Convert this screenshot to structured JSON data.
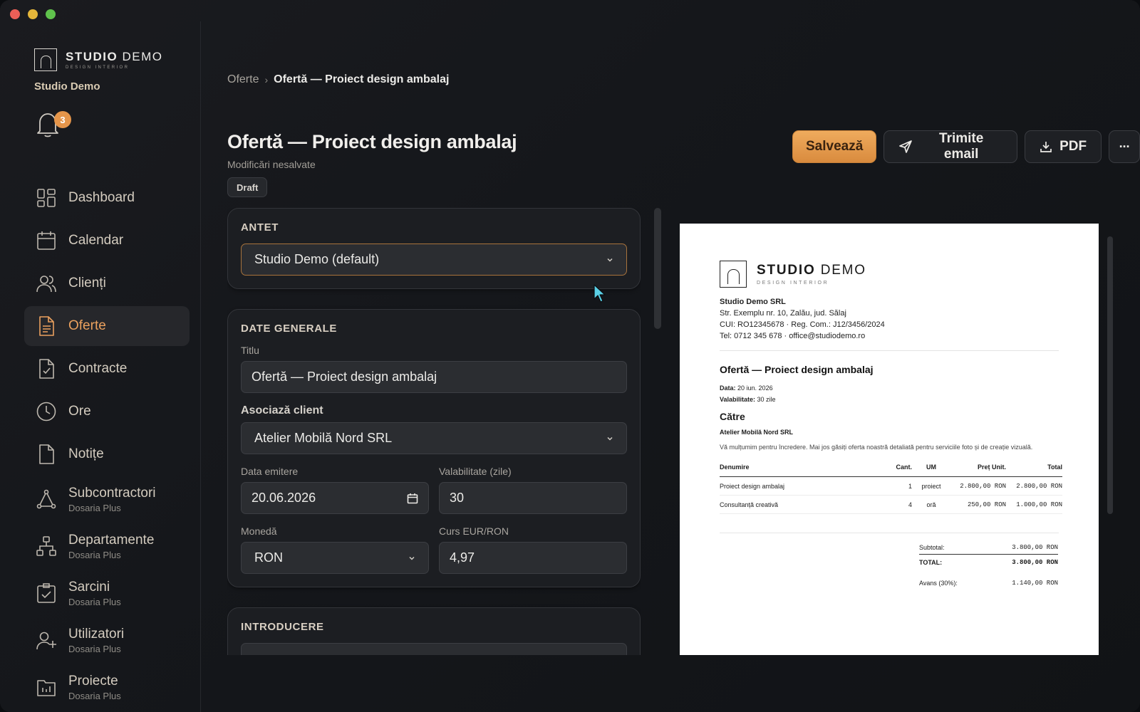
{
  "sidebar": {
    "brand": {
      "name_bold": "STUDIO",
      "name_light": "DEMO",
      "tagline": "DESIGN INTERIOR"
    },
    "org_name": "Studio Demo",
    "notifications_count": "3",
    "items": [
      {
        "label": "Dashboard",
        "icon": "grid-icon",
        "sub": ""
      },
      {
        "label": "Calendar",
        "icon": "calendar-icon",
        "sub": ""
      },
      {
        "label": "Clienți",
        "icon": "users-icon",
        "sub": ""
      },
      {
        "label": "Oferte",
        "icon": "document-icon",
        "sub": "",
        "active": true
      },
      {
        "label": "Contracte",
        "icon": "contract-icon",
        "sub": ""
      },
      {
        "label": "Ore",
        "icon": "clock-icon",
        "sub": ""
      },
      {
        "label": "Notițe",
        "icon": "note-icon",
        "sub": ""
      },
      {
        "label": "Subcontractori",
        "icon": "network-icon",
        "sub": "Dosaria Plus"
      },
      {
        "label": "Departamente",
        "icon": "org-chart-icon",
        "sub": "Dosaria Plus"
      },
      {
        "label": "Sarcini",
        "icon": "task-icon",
        "sub": "Dosaria Plus"
      },
      {
        "label": "Utilizatori",
        "icon": "add-user-icon",
        "sub": "Dosaria Plus"
      },
      {
        "label": "Proiecte",
        "icon": "folder-icon",
        "sub": "Dosaria Plus"
      }
    ]
  },
  "breadcrumb": {
    "parent": "Oferte",
    "separator": "›",
    "current": "Ofertă — Proiect design ambalaj"
  },
  "header": {
    "title": "Ofertă — Proiect design ambalaj",
    "unsaved": "Modificări nesalvate",
    "status": "Draft",
    "save_label": "Salvează",
    "email_label": "Trimite email",
    "pdf_label": "PDF",
    "more_label": "···"
  },
  "form": {
    "antet": {
      "heading": "ANTET",
      "selected": "Studio Demo (default)"
    },
    "general": {
      "heading": "DATE GENERALE",
      "title_label": "Titlu",
      "title_value": "Ofertă — Proiect design ambalaj",
      "client_label": "Asociază client",
      "client_value": "Atelier Mobilă Nord SRL",
      "issue_date_label": "Data emitere",
      "issue_date_value": "20.06.2026",
      "validity_label": "Valabilitate (zile)",
      "validity_value": "30",
      "currency_label": "Monedă",
      "currency_value": "RON",
      "rate_label": "Curs EUR/RON",
      "rate_value": "4,97"
    },
    "intro": {
      "heading": "INTRODUCERE"
    }
  },
  "preview": {
    "brand": {
      "name_bold": "STUDIO",
      "name_light": "DEMO",
      "tagline": "DESIGN INTERIOR"
    },
    "company_name": "Studio Demo SRL",
    "address": "Str. Exemplu nr. 10, Zalău, jud. Sălaj",
    "registry": "CUI: RO12345678 · Reg. Com.: J12/3456/2024",
    "contact": "Tel: 0712 345 678 · office@studiodemo.ro",
    "title": "Ofertă — Proiect design ambalaj",
    "date_label": "Data:",
    "date_value": "20 iun. 2026",
    "validity_label": "Valabilitate:",
    "validity_value": "30 zile",
    "to_heading": "Către",
    "client": "Atelier Mobilă Nord SRL",
    "intro": "Vă mulțumim pentru încredere. Mai jos găsiți oferta noastră detaliată pentru serviciile foto și de creație vizuală.",
    "columns": {
      "name": "Denumire",
      "qty": "Cant.",
      "unit": "UM",
      "price": "Preț Unit.",
      "total": "Total"
    },
    "items": [
      {
        "name": "Proiect design ambalaj",
        "qty": "1",
        "unit": "proiect",
        "price": "2.800,00 RON",
        "total": "2.800,00 RON"
      },
      {
        "name": "Consultanță creativă",
        "qty": "4",
        "unit": "oră",
        "price": "250,00 RON",
        "total": "1.000,00 RON"
      }
    ],
    "totals": {
      "subtotal_label": "Subtotal:",
      "subtotal_value": "3.800,00 RON",
      "total_label": "TOTAL:",
      "total_value": "3.800,00 RON",
      "advance_label": "Avans (30%):",
      "advance_value": "1.140,00 RON"
    }
  },
  "colors": {
    "accent": "#eba15e",
    "primary_button": "#e59a4c",
    "background": "#15171b",
    "card": "#1c1e22"
  }
}
